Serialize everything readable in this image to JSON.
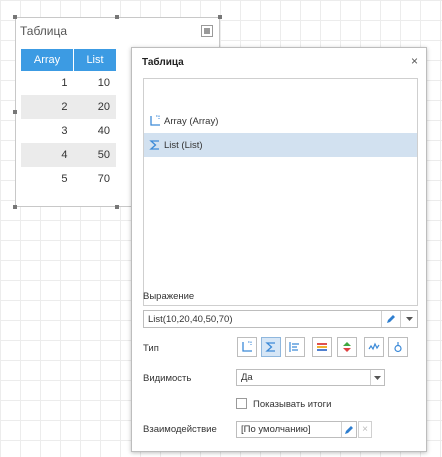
{
  "widget": {
    "title": "Таблица",
    "columns": [
      "Array",
      "List"
    ],
    "rows": [
      {
        "array": "1",
        "list": "10"
      },
      {
        "array": "2",
        "list": "20"
      },
      {
        "array": "3",
        "list": "40"
      },
      {
        "array": "4",
        "list": "50"
      },
      {
        "array": "5",
        "list": "70"
      }
    ]
  },
  "dialog": {
    "title": "Таблица",
    "close": "×",
    "series": [
      {
        "label": "Array (Array)",
        "icon": "array-axis-icon",
        "selected": false
      },
      {
        "label": "List (List)",
        "icon": "sigma-icon",
        "selected": true
      }
    ],
    "expression_label": "Выражение",
    "expression_value": "List(10,20,40,50,70)",
    "type_label": "Тип",
    "type_icons": [
      "axis-icon",
      "sigma-icon",
      "align-left-icon",
      "color-bars-icon",
      "up-down-icon",
      "sparkline-icon",
      "indicator-icon"
    ],
    "type_active_index": 1,
    "visibility_label": "Видимость",
    "visibility_value": "Да",
    "totals_label": "Показывать итоги",
    "interaction_label": "Взаимодействие",
    "interaction_value": "[По умолчанию]",
    "accent_color": "#3c9be3"
  }
}
